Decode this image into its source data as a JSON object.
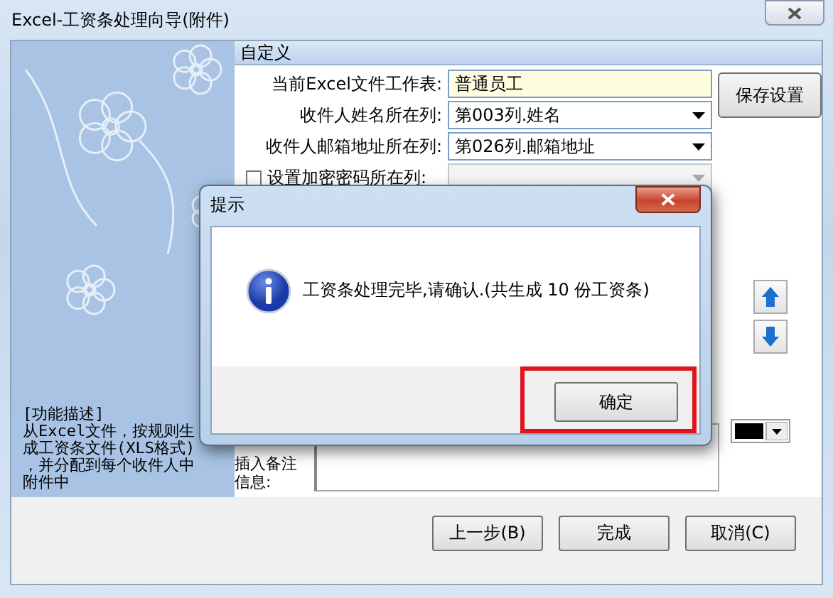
{
  "window": {
    "title": "Excel-工资条处理向导(附件)"
  },
  "sidebar": {
    "description": [
      "[功能描述]",
      "从Excel文件，按规则生",
      "成工资条文件(XLS格式)",
      "，并分配到每个收件人中",
      "附件中"
    ]
  },
  "section": {
    "title": "自定义"
  },
  "fields": [
    {
      "kind": "text",
      "label": "当前Excel文件工作表:",
      "value": "普通员工"
    },
    {
      "kind": "select",
      "label": "收件人姓名所在列:",
      "value": "第003列.姓名"
    },
    {
      "kind": "select",
      "label": "收件人邮箱地址所在列:",
      "value": "第026列.邮箱地址"
    },
    {
      "kind": "check-select",
      "label": "设置加密密码所在列:",
      "checked": false,
      "disabled": true
    }
  ],
  "save_button": "保存设置",
  "remark": {
    "label": "插入备注信息:"
  },
  "buttons": [
    "上一步(B)",
    "完成",
    "取消(C)"
  ],
  "dialog": {
    "title": "提示",
    "message": "工资条处理完毕,请确认.(共生成 10 份工资条)",
    "button": "确定"
  }
}
